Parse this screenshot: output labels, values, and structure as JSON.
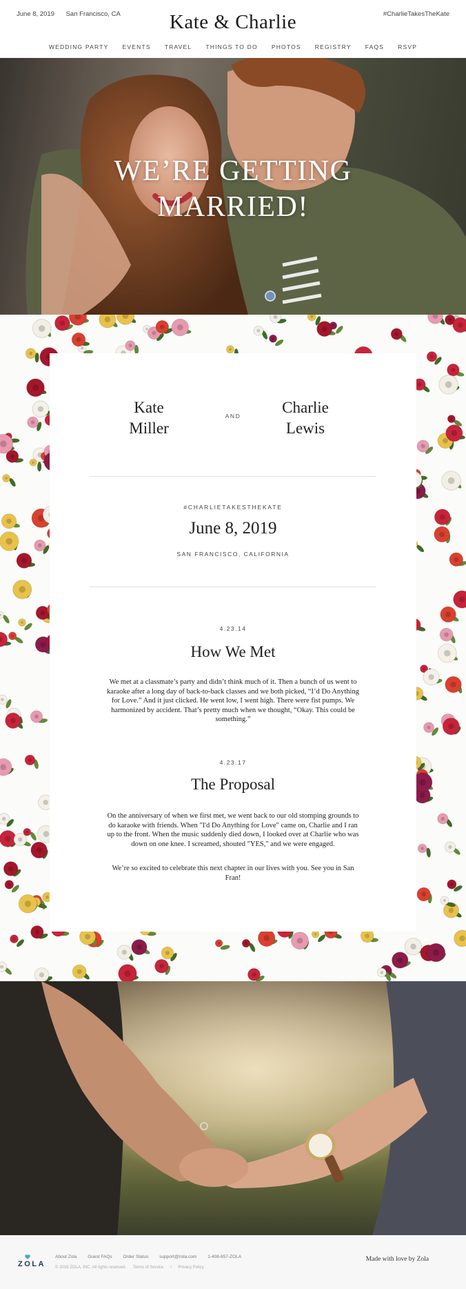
{
  "header": {
    "date": "June 8, 2019",
    "location": "San Francisco, CA",
    "title": "Kate & Charlie",
    "hashtag": "#CharlieTakesTheKate",
    "nav": [
      "WEDDING PARTY",
      "EVENTS",
      "TRAVEL",
      "THINGS TO DO",
      "PHOTOS",
      "REGISTRY",
      "FAQS",
      "RSVP"
    ]
  },
  "hero": {
    "line1": "WE’RE GETTING",
    "line2": "MARRIED!"
  },
  "couple": {
    "bride_first": "Kate",
    "bride_last": "Miller",
    "and": "AND",
    "groom_first": "Charlie",
    "groom_last": "Lewis"
  },
  "event": {
    "hashtag": "#CHARLIETAKESTHEKATE",
    "date": "June 8, 2019",
    "location": "SAN FRANCISCO, CALIFORNIA"
  },
  "stories": [
    {
      "date": "4.23.14",
      "title": "How We Met",
      "body": "We met at a classmate’s party and didn’t think much of it. Then a bunch of us went to karaoke after a long day of back-to-back classes and we both picked, “I’d Do Anything for Love.” And it just clicked. He went low, I went high. There were fist pumps. We harmonized by accident. That’s pretty much when we thought, “Okay. This could be something.”"
    },
    {
      "date": "4.23.17",
      "title": "The Proposal",
      "body": "On the anniversary of when we first met, we went back to our old stomping grounds to do karaoke with friends. When \"I'd Do Anything for Love\" came on, Charlie and I ran up to the front. When the music suddenly died down, I looked over at Charlie who was down on one knee. I screamed, shouted \"YES,\" and we were engaged.",
      "closing": "We’re so excited to celebrate this next chapter in our lives with you. See you in San Fran!"
    }
  ],
  "footer": {
    "logo": "ZOLA",
    "links": [
      "About Zola",
      "Guest FAQs",
      "Order Status",
      "support@zola.com",
      "1-408-657-ZOLA"
    ],
    "copyright": "© 2016 ZOLA, INC.  All rights reserved.",
    "legal": [
      "Terms of Service",
      "/",
      "Privacy Policy"
    ],
    "made_with": "Made with love by Zola"
  }
}
